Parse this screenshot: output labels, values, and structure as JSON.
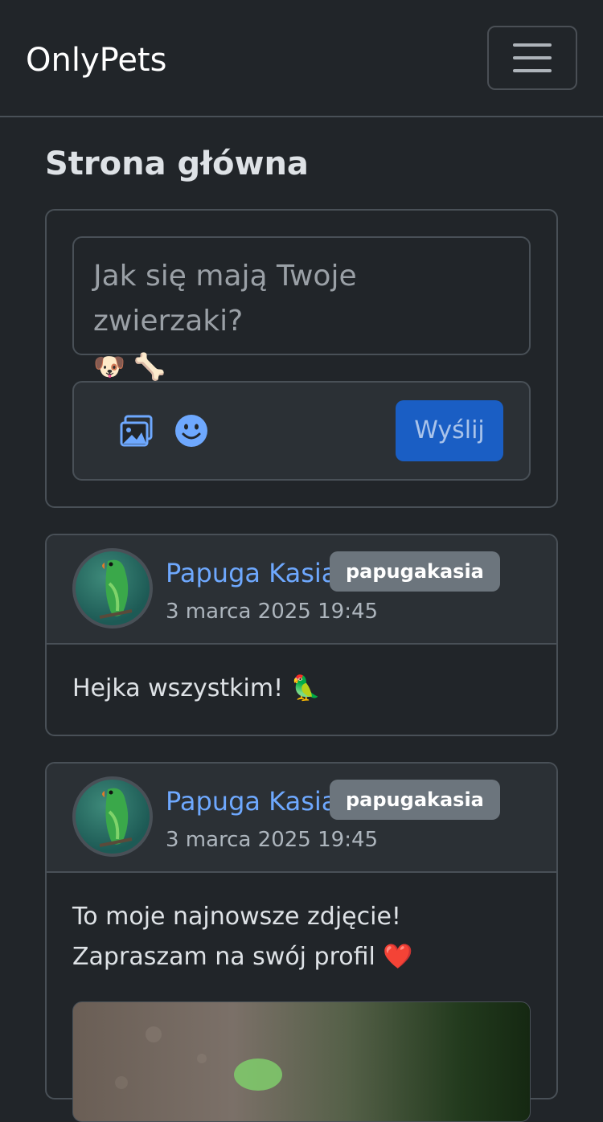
{
  "navbar": {
    "brand": "OnlyPets",
    "menu_icon": "hamburger-icon"
  },
  "page": {
    "title": "Strona główna"
  },
  "composer": {
    "placeholder": "Jak się mają Twoje zwierzaki?",
    "placeholder_emojis": "🐶 🦴",
    "image_icon": "image-icon",
    "emoji_icon": "smiley-icon",
    "send_label": "Wyślij"
  },
  "posts": [
    {
      "author": "Papuga Kasia",
      "username": "papugakasia",
      "date": "3 marca 2025 19:45",
      "text": "Hejka wszystkim! 🦜"
    },
    {
      "author": "Papuga Kasia",
      "username": "papugakasia",
      "date": "3 marca 2025 19:45",
      "text": "To moje najnowsze zdjęcie! Zapraszam na swój profil ❤️"
    }
  ],
  "colors": {
    "background": "#212529",
    "accent": "#6ea8fe",
    "send_button": "#1a5ec4",
    "badge": "#6c757d"
  }
}
